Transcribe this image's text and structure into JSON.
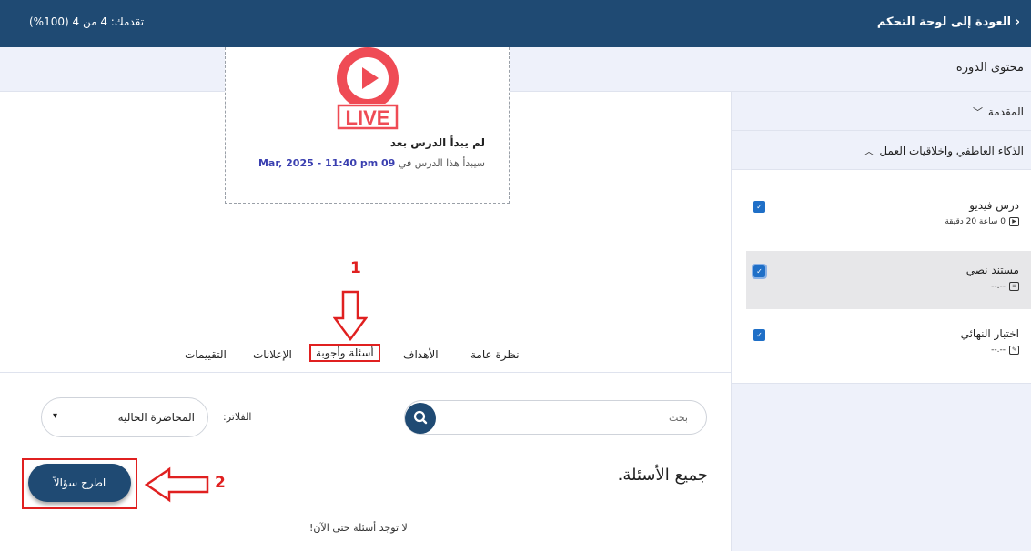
{
  "topbar": {
    "back_label": "العودة إلى لوحة التحكم",
    "progress_label": "تقدمك: 4 من 4 (100%)"
  },
  "subbar": {
    "course_content": "محتوى الدورة"
  },
  "sidebar": {
    "sections": [
      {
        "title": "المقدمة",
        "expanded": false
      },
      {
        "title": "الذكاء العاطفي واخلاقيات العمل",
        "expanded": true
      }
    ],
    "lessons": [
      {
        "title": "درس فيديو",
        "meta": "0 ساعة 20 دقيقة",
        "icon": "video-icon",
        "active": false
      },
      {
        "title": "مستند نصي",
        "meta": "--.--",
        "icon": "document-icon",
        "active": true
      },
      {
        "title": "اختبار النهائي",
        "meta": "--.--",
        "icon": "quiz-icon",
        "active": false
      }
    ]
  },
  "video": {
    "live_text": "LIVE",
    "not_started": "لم يبدأ الدرس بعد",
    "starts_prefix": "سيبدأ هذا الدرس في",
    "starts_date": "09 Mar, 2025 - 11:40 pm"
  },
  "annotations": {
    "one": "1",
    "two": "2"
  },
  "tabs": [
    "نظرة عامة",
    "الأهداف",
    "أسئلة وأجوبة",
    "الإعلانات",
    "التقييمات"
  ],
  "search": {
    "placeholder": "بحث"
  },
  "filter": {
    "label": "الفلاتر:",
    "selected": "المحاضرة الحالية"
  },
  "questions": {
    "heading": "جميع الأسئلة.",
    "ask_button": "اطرح سؤالاً",
    "empty": "لا توجد أسئلة حتى الآن!"
  },
  "colors": {
    "primary": "#1f4a73",
    "annotation": "#e02020",
    "live": "#ef4b55"
  }
}
